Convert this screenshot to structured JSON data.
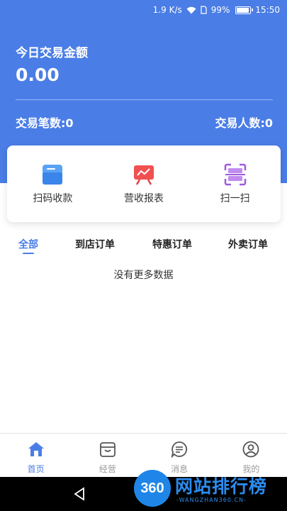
{
  "status_bar": {
    "speed": "1.9 K/s",
    "battery": "99%",
    "time": "15:50",
    "battery_level": 0.99
  },
  "header": {
    "title": "今日交易金额",
    "amount": "0.00",
    "tx_count": "交易笔数:0",
    "tx_people": "交易人数:0"
  },
  "actions": [
    {
      "label": "扫码收款",
      "icon": "scan-pay-icon"
    },
    {
      "label": "营收报表",
      "icon": "report-chart-icon"
    },
    {
      "label": "扫一扫",
      "icon": "scan-frame-icon"
    }
  ],
  "tabs": [
    {
      "label": "全部",
      "active": true
    },
    {
      "label": "到店订单",
      "active": false
    },
    {
      "label": "特惠订单",
      "active": false
    },
    {
      "label": "外卖订单",
      "active": false
    }
  ],
  "empty_text": "没有更多数据",
  "bottom_nav": [
    {
      "label": "首页",
      "icon": "home-icon",
      "active": true
    },
    {
      "label": "经营",
      "icon": "box-icon",
      "active": false
    },
    {
      "label": "消息",
      "icon": "message-icon",
      "active": false
    },
    {
      "label": "我的",
      "icon": "user-icon",
      "active": false
    }
  ],
  "watermark": {
    "badge": "360",
    "text": "网站排行榜",
    "sub": "-WANGZHAN360.CN-"
  },
  "colors": {
    "primary": "#4a7de6",
    "text": "#333333",
    "inactive": "#9a9a9a"
  }
}
